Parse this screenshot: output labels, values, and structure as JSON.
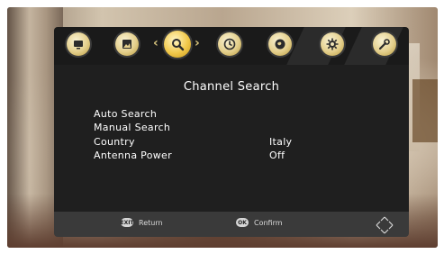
{
  "menu": {
    "tabs": [
      {
        "name": "tv-icon"
      },
      {
        "name": "picture-icon"
      },
      {
        "name": "search-icon",
        "active": true
      },
      {
        "name": "clock-icon"
      },
      {
        "name": "globe-icon"
      },
      {
        "name": "settings-gear-icon"
      },
      {
        "name": "tools-icon"
      }
    ],
    "arrows": {
      "left": "‹",
      "right": "›"
    }
  },
  "panel": {
    "title": "Channel Search",
    "rows": [
      {
        "label": "Auto Search",
        "value": ""
      },
      {
        "label": "Manual Search",
        "value": ""
      },
      {
        "label": "Country",
        "value": "Italy"
      },
      {
        "label": "Antenna Power",
        "value": "Off"
      }
    ]
  },
  "footer": {
    "return_key": "EXIT",
    "return_label": "Return",
    "confirm_key": "OK",
    "confirm_label": "Confirm"
  },
  "colors": {
    "panel_bg": "#1f1f1f",
    "topbar_bg": "#1a1a1a",
    "bottombar_bg": "#3a3a3a",
    "icon_gold": "#e4cf8c",
    "text": "#ffffff"
  }
}
